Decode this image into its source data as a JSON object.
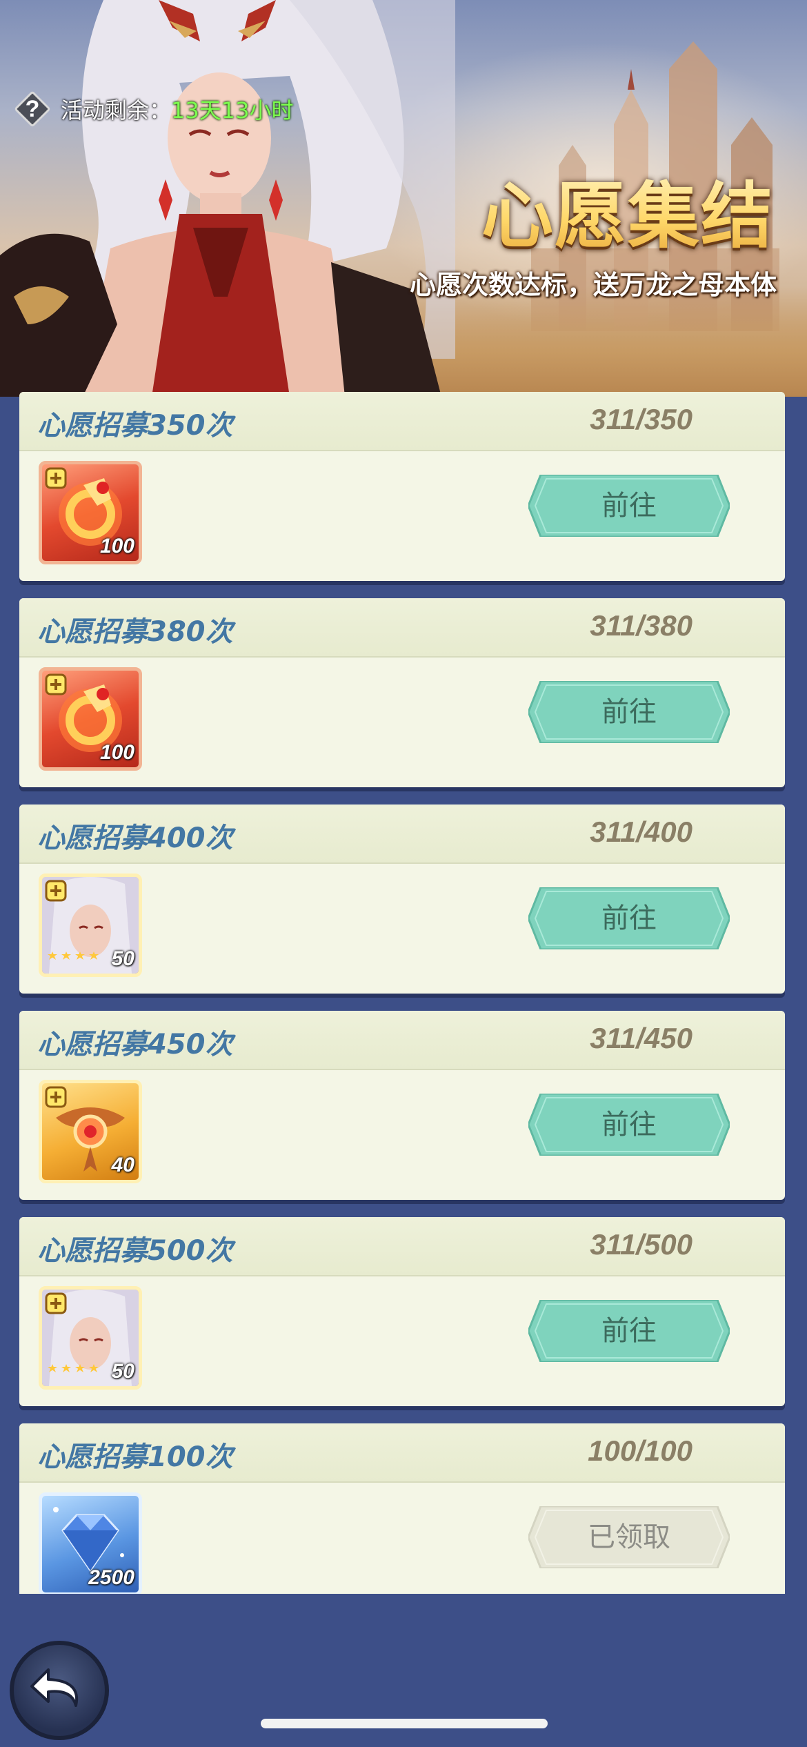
{
  "header": {
    "timer_label": "活动剩余：",
    "timer_value": "13天13小时",
    "title": "心愿集结",
    "subtitle": "心愿次数达标，送万龙之母本体"
  },
  "tasks": [
    {
      "title": "心愿招募350次",
      "progress": "311/350",
      "item_icon": "fire-ring-icon",
      "item_count": "100",
      "button_label": "前往",
      "claimed": false
    },
    {
      "title": "心愿招募380次",
      "progress": "311/380",
      "item_icon": "fire-ring-icon",
      "item_count": "100",
      "button_label": "前往",
      "claimed": false
    },
    {
      "title": "心愿招募400次",
      "progress": "311/400",
      "item_icon": "hero-portrait-icon",
      "item_count": "50",
      "button_label": "前往",
      "claimed": false
    },
    {
      "title": "心愿招募450次",
      "progress": "311/450",
      "item_icon": "dragon-emblem-icon",
      "item_count": "40",
      "button_label": "前往",
      "claimed": false
    },
    {
      "title": "心愿招募500次",
      "progress": "311/500",
      "item_icon": "hero-portrait-icon",
      "item_count": "50",
      "button_label": "前往",
      "claimed": false
    },
    {
      "title": "心愿招募100次",
      "progress": "100/100",
      "item_icon": "diamond-icon",
      "item_count": "2500",
      "button_label": "已领取",
      "claimed": true
    }
  ],
  "colors": {
    "background": "#3d4f88",
    "card": "#f4f6e6",
    "title_blue": "#4377a4",
    "go_button": "#7fd3bd",
    "timer_green": "#7dff4f"
  }
}
